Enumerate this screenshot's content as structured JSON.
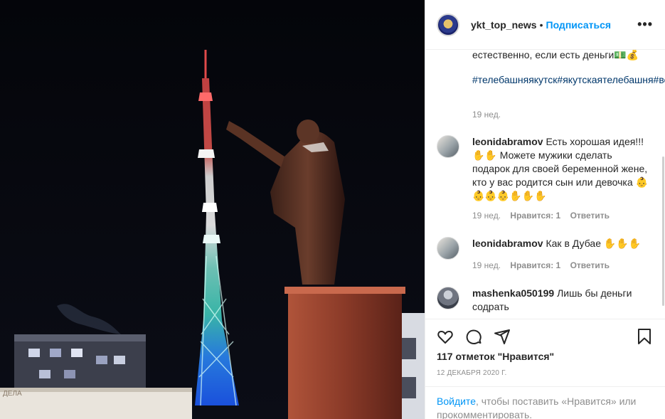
{
  "post": {
    "image_alt": "Подсвеченная телебашня и памятник Ленину ночью",
    "shop_sign": "ДЕЛА"
  },
  "header": {
    "username": "ykt_top_news",
    "separator": "•",
    "follow_label": "Подписаться",
    "more_label": "•••"
  },
  "caption": {
    "text": "естественно, если есть деньги💵💰",
    "hashtags": "#телебашняякутск#якутскаятелебашня#всёкупить#всёпродать",
    "time": "19 нед."
  },
  "comments": [
    {
      "username": "leonidabramov",
      "text": "Есть хорошая идея!!! ✋✋ Можете мужики сделать подарок для своей беременной жене, кто у вас родится сын или девочка 👶👶👶👶✋✋✋",
      "time": "19 нед.",
      "likes": "Нравится: 1",
      "reply": "Ответить"
    },
    {
      "username": "leonidabramov",
      "text": "Как в Дубае ✋✋✋",
      "time": "19 нед.",
      "likes": "Нравится: 1",
      "reply": "Ответить"
    },
    {
      "username": "mashenka050199",
      "text": "Лишь бы деньги содрать"
    }
  ],
  "actions": {
    "like_icon": "heart-icon",
    "comment_icon": "comment-icon",
    "share_icon": "share-icon",
    "save_icon": "bookmark-icon",
    "likes_count": "117 отметок \"Нравится\"",
    "date": "12 декабря 2020 г."
  },
  "login_prompt": {
    "link": "Войдите",
    "text": ", чтобы поставить «Нравится» или прокомментировать."
  },
  "colors": {
    "accent": "#0095f6",
    "hashtag": "#00376b",
    "muted": "#8e8e8e"
  }
}
